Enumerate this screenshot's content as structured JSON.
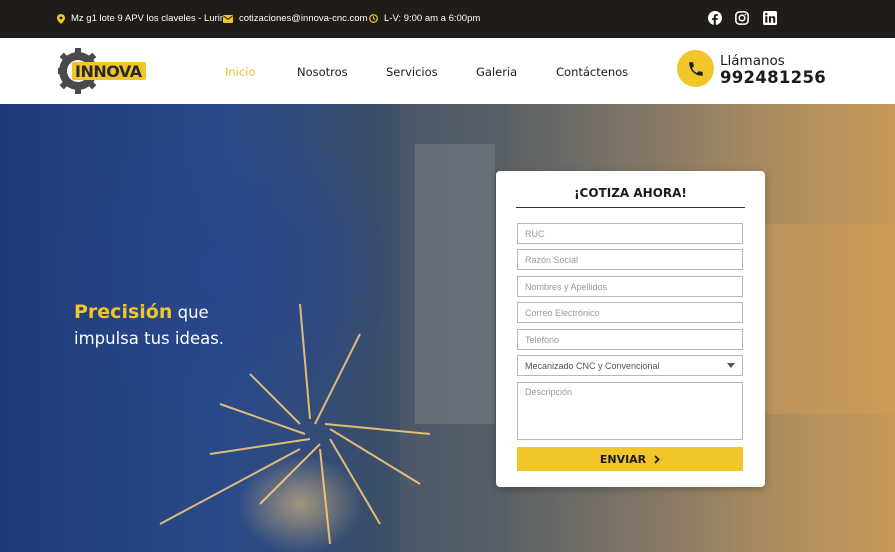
{
  "topbar": {
    "address": "Mz g1 lote 9 APV los claveles - Lurin",
    "email": "cotizaciones@innova-cnc.com",
    "hours": "L-V: 9:00 am a 6:00pm",
    "social": [
      "facebook-icon",
      "instagram-icon",
      "linkedin-icon"
    ]
  },
  "header": {
    "logo_text": "INNOVA",
    "nav": [
      "Inicio",
      "Nosotros",
      "Servicios",
      "Galeria",
      "Contáctenos"
    ],
    "active_nav": "Inicio",
    "call_label": "Llámanos",
    "call_number": "992481256"
  },
  "hero": {
    "tagline_highlight": "Precisión",
    "tagline_rest_1": " que",
    "tagline_line_2": "impulsa tus ideas."
  },
  "form": {
    "title": "¡COTIZA AHORA!",
    "ruc_placeholder": "RUC",
    "razon_placeholder": "Razón Social",
    "nombres_placeholder": "Nombres y Apellidos",
    "correo_placeholder": "Correo Electrónico",
    "telefono_placeholder": "Teléfono",
    "servicio_selected": "Mecanizado CNC y Convencional",
    "descripcion_placeholder": "Descripción",
    "submit_label": "ENVIAR"
  },
  "colors": {
    "accent": "#f2c62b",
    "topbar_bg": "#201c17",
    "text_dark": "#1c1c1c"
  }
}
